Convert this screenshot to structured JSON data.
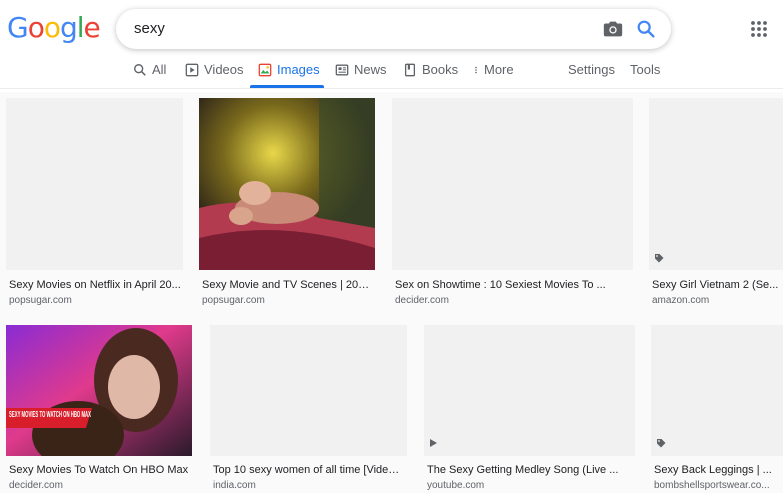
{
  "logo": {
    "letters": [
      "G",
      "o",
      "o",
      "g",
      "l",
      "e"
    ],
    "colors": [
      "#4285f4",
      "#ea4335",
      "#fbbc05",
      "#4285f4",
      "#34a853",
      "#ea4335"
    ]
  },
  "search": {
    "query": "sexy"
  },
  "tabs": [
    {
      "label": "All",
      "icon": "search-icon"
    },
    {
      "label": "Videos",
      "icon": "video-icon"
    },
    {
      "label": "Images",
      "icon": "image-icon",
      "active": true
    },
    {
      "label": "News",
      "icon": "news-icon"
    },
    {
      "label": "Books",
      "icon": "book-icon"
    },
    {
      "label": "More",
      "icon": "more-vert-icon"
    },
    {
      "label": "Settings"
    },
    {
      "label": "Tools"
    }
  ],
  "results": [
    {
      "title": "Sexy Movies on Netflix in April 20...",
      "source": "popsugar.com"
    },
    {
      "title": "Sexy Movie and TV Scenes | 2019...",
      "source": "popsugar.com"
    },
    {
      "title": "Sex on Showtime : 10 Sexiest Movies To ...",
      "source": "decider.com"
    },
    {
      "title": "Sexy Girl Vietnam 2 (Se...",
      "source": "amazon.com",
      "badge": "tag-icon"
    },
    {
      "title": "Sexy Movies To Watch On HBO Max",
      "source": "decider.com",
      "overlay": "SEXY MOVIES TO WATCH ON HBO MAX"
    },
    {
      "title": "Top 10 sexy women of all time [Video ...",
      "source": "india.com"
    },
    {
      "title": "The Sexy Getting Medley Song (Live ...",
      "source": "youtube.com",
      "badge": "play-icon"
    },
    {
      "title": "Sexy Back Leggings | ...",
      "source": "bombshellsportswear.co...",
      "badge": "tag-icon"
    }
  ],
  "colors": {
    "accent": "#1a73e8",
    "text": "#202124",
    "muted": "#5f6368"
  }
}
